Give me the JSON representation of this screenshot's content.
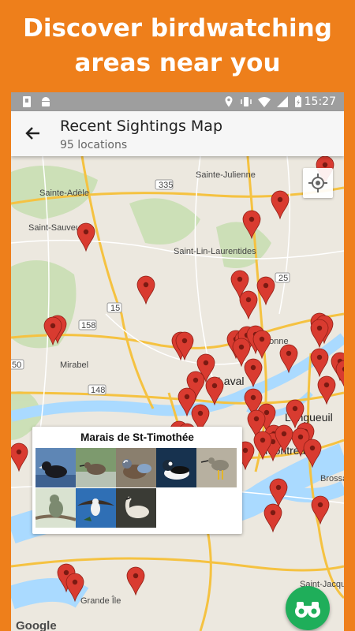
{
  "promo": {
    "line1": "Discover birdwatching",
    "line2": "areas near you"
  },
  "status_bar": {
    "time": "15:27"
  },
  "app_bar": {
    "title": "Recent Sightings Map",
    "subtitle": "95 locations"
  },
  "map": {
    "places": [
      "Sainte-Julienne",
      "Sainte-Adèle",
      "Saint-Sauveur",
      "Saint-Lin-Laurentides",
      "Terrebonne",
      "Mirabel",
      "Laval",
      "Longueuil",
      "Montreal",
      "Brossard",
      "Grande Île",
      "Saint-Jacques"
    ],
    "road_shields": [
      "335",
      "25",
      "15",
      "158",
      "50",
      "148"
    ],
    "attribution": "Google"
  },
  "popup": {
    "title": "Marais de St-Timothée",
    "birds": [
      "american-coot",
      "shorebird",
      "blue-winged-teal",
      "bufflehead",
      "greater-yellowlegs",
      "flycatcher",
      "osprey",
      "goose"
    ]
  },
  "colors": {
    "brand_orange": "#EE7F1B",
    "marker_red": "#D93B30",
    "fab_green": "#1FAE5A"
  }
}
